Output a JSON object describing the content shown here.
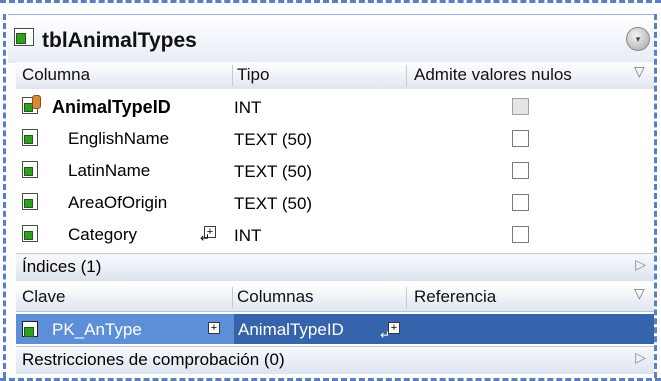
{
  "table": {
    "title": "tblAnimalTypes",
    "collapse_glyph": "▾",
    "columns_header": {
      "name": "Columna",
      "type": "Tipo",
      "nullable": "Admite valores nulos"
    },
    "columns": [
      {
        "name": "AnimalTypeID",
        "type": "INT",
        "nullable": false,
        "primary_key": true
      },
      {
        "name": "EnglishName",
        "type": "TEXT (50)",
        "nullable": false
      },
      {
        "name": "LatinName",
        "type": "TEXT (50)",
        "nullable": false
      },
      {
        "name": "AreaOfOrigin",
        "type": "TEXT (50)",
        "nullable": false
      },
      {
        "name": "Category",
        "type": "INT",
        "nullable": false,
        "has_relation": true
      }
    ],
    "indices_section": "Índices (1)",
    "indices_header": {
      "key": "Clave",
      "columns": "Columnas",
      "reference": "Referencia"
    },
    "indices": [
      {
        "key": "PK_AnType",
        "columns": "AnimalTypeID",
        "reference": ""
      }
    ],
    "checks_section": "Restricciones de comprobación (0)"
  },
  "colors": {
    "accent_dash": "#5a7fc6",
    "selected_row": "#3563ac",
    "key_icon_green": "#2f9e22"
  }
}
